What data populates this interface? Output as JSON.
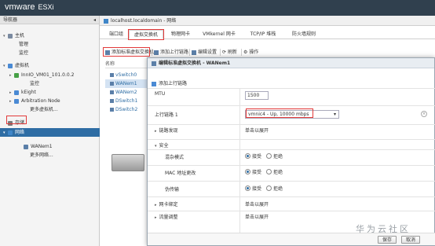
{
  "app": {
    "logo_brand": "vmware",
    "logo_product": "ESXi"
  },
  "navigator": {
    "title": "导航器",
    "items": [
      {
        "label": "主机",
        "icon": "host-icon",
        "caret": "▾"
      },
      {
        "label": "管理"
      },
      {
        "label": "监控"
      },
      {
        "label": "虚拟机",
        "icon": "vm-icon",
        "caret": "▾"
      },
      {
        "label": "InnIO_VM01_101.0.0.2",
        "icon": "vm-on-icon",
        "caret": "▸"
      },
      {
        "label": "监控"
      },
      {
        "label": "kEight",
        "icon": "vm-icon",
        "caret": "▸"
      },
      {
        "label": "Arbitration Node",
        "icon": "vm-icon",
        "caret": "▸"
      },
      {
        "label": "更多虚拟机..."
      },
      {
        "label": "存储",
        "icon": "storage-icon"
      },
      {
        "label": "网络",
        "icon": "network-icon",
        "caret": "▾"
      },
      {
        "label": "WANem1",
        "icon": "switch-icon"
      },
      {
        "label": "更多网络..."
      }
    ]
  },
  "breadcrumb": "localhost.localdomain - 网络",
  "tabs": [
    "端口组",
    "虚拟交换机",
    "物理网卡",
    "VMkernel 网卡",
    "TCP/IP 堆栈",
    "防火墙规则"
  ],
  "toolbar": {
    "add_vswitch": "添加标准虚拟交换机",
    "add_uplink": "添加上行链路",
    "edit": "编辑设置",
    "refresh": "刷新",
    "actions": "操作"
  },
  "list": {
    "header": "名称",
    "rows": [
      "vSwitch0",
      "WANem1",
      "WANem2",
      "DSwitch1",
      "DSwitch2"
    ]
  },
  "modal": {
    "title": "编辑标准虚拟交换机 - WANem1",
    "add_uplink": "添加上行链路",
    "mtu_label": "MTU",
    "mtu_value": "1500",
    "uplink_label": "上行链路 1",
    "uplink_value": "vmnic4 - Up, 10000 mbps",
    "link_discovery_label": "链路发现",
    "link_discovery_value": "单击以展开",
    "security_label": "安全",
    "promiscuous_label": "混杂模式",
    "mac_change_label": "MAC 地址更改",
    "forged_label": "伪传输",
    "accept": "接受",
    "reject": "拒绝",
    "nic_teaming_label": "网卡绑定",
    "nic_teaming_value": "单击以展开",
    "traffic_shaping_label": "流量调整",
    "traffic_shaping_value": "单击以展开",
    "save": "保存",
    "cancel": "取消"
  },
  "watermark": "华为云社区",
  "colors": {
    "accent": "#2e6da4",
    "annotation": "#e23a3a",
    "topbar": "#30404e"
  }
}
